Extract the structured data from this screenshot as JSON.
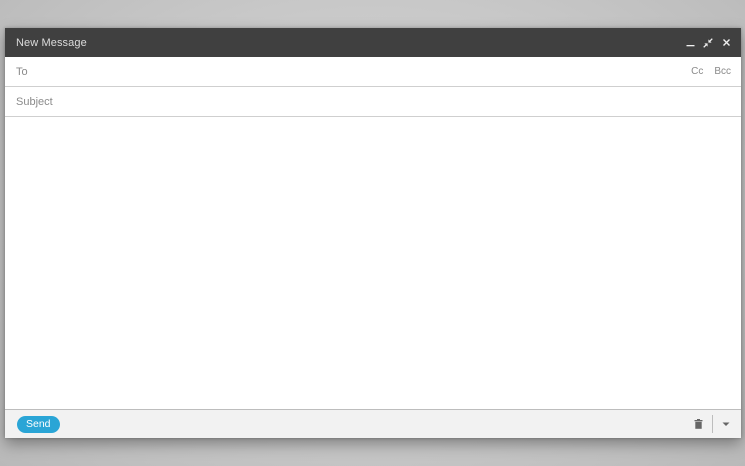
{
  "window": {
    "title": "New Message"
  },
  "fields": {
    "to_label": "To",
    "to_value": "",
    "cc_label": "Cc",
    "bcc_label": "Bcc",
    "subject_placeholder": "Subject",
    "subject_value": ""
  },
  "body": {
    "value": ""
  },
  "footer": {
    "send_label": "Send"
  },
  "icons": {
    "minimize": "minimize-icon",
    "collapse": "collapse-arrows-icon",
    "close": "close-icon",
    "trash": "trash-icon",
    "more": "chevron-down-icon"
  },
  "colors": {
    "titlebar": "#404040",
    "send_button": "#2aa5d6"
  }
}
